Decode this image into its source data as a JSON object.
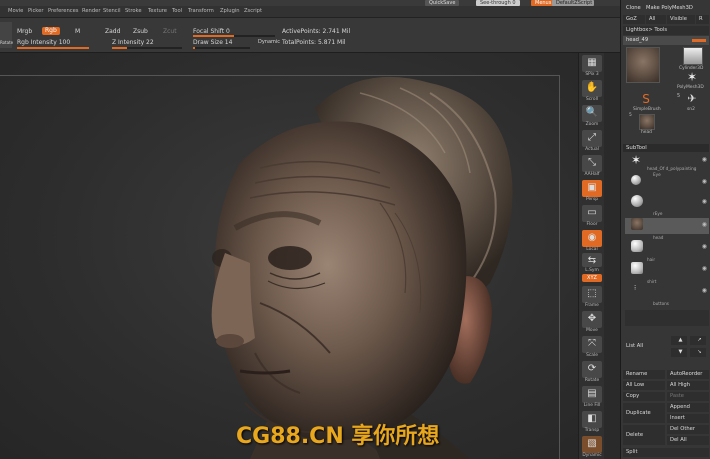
{
  "titlebar": {
    "quicksave": "QuickSave",
    "seethrough": "See-through 0",
    "menus": "Menus",
    "defaultscript": "DefaultZScript"
  },
  "menubar": {
    "items": [
      "Movie",
      "Picker",
      "Preferences",
      "Render",
      "Stencil",
      "Stroke",
      "Texture",
      "Tool",
      "Transform",
      "Zplugin",
      "Zscript"
    ]
  },
  "toolbar": {
    "mrgb": "Mrgb",
    "rgb": "Rgb",
    "m": "M",
    "zadd": "Zadd",
    "zsub": "Zsub",
    "zcut": "Zcut",
    "rgb_intensity": "Rgb Intensity 100",
    "z_intensity": "Z Intensity 22",
    "focal_shift": "Focal Shift 0",
    "draw_size": "Draw Size 14",
    "dynamic": "Dynamic",
    "active_points": "ActivePoints: 2.741 Mil",
    "total_points": "TotalPoints: 5.871 Mil",
    "rgb_intensity_value": 100,
    "z_intensity_value": 22,
    "focal_shift_value": 0,
    "draw_size_value": 14,
    "left_icon_label": "Rotate"
  },
  "shelf": {
    "items": [
      {
        "label": "SPix 3",
        "glyph": "▦"
      },
      {
        "label": "Scroll",
        "glyph": "✋"
      },
      {
        "label": "Zoom",
        "glyph": "🔍"
      },
      {
        "label": "Actual",
        "glyph": "⤢"
      },
      {
        "label": "AAHalf",
        "glyph": "⤡"
      },
      {
        "label": "Persp",
        "glyph": "▣"
      },
      {
        "label": "Floor",
        "glyph": "▭"
      },
      {
        "label": "Local",
        "glyph": "◉"
      },
      {
        "label": "L.Sym",
        "glyph": "⇆"
      },
      {
        "label": "Frame",
        "glyph": "⬚"
      },
      {
        "label": "Move",
        "glyph": "✥"
      },
      {
        "label": "Scale",
        "glyph": "⤧"
      },
      {
        "label": "Rotate",
        "glyph": "⟳"
      },
      {
        "label": "Line Fill",
        "glyph": "▤"
      },
      {
        "label": "Transp",
        "glyph": "◧"
      },
      {
        "label": "Dynamic",
        "glyph": "▧"
      }
    ],
    "xyz": "XYZ"
  },
  "panel": {
    "clone": "Clone",
    "make_polymesh": "Make PolyMesh3D",
    "goz": "GoZ",
    "all": "All",
    "visible": "Visible",
    "r": "R",
    "lightbox_tools": "Lightbox> Tools",
    "head_slider": "head_49",
    "head_value": "49",
    "tools": [
      {
        "name": "Cylinder3D"
      },
      {
        "name": "PolyMesh3D"
      },
      {
        "name": "SimpleBrush"
      },
      {
        "name": "sn2"
      },
      {
        "name": "head"
      },
      {
        "name": "5"
      }
    ],
    "subtool_header": "SubTool",
    "subtools": [
      {
        "name": "head_Of d_polypainting"
      },
      {
        "name": "Eye"
      },
      {
        "name": "rEye"
      },
      {
        "name": "head"
      },
      {
        "name": "hair"
      },
      {
        "name": "shirt"
      },
      {
        "name": "buttons"
      }
    ],
    "list_all": "List All",
    "actions": [
      [
        "Rename",
        "AutoReorder"
      ],
      [
        "All Low",
        "All High"
      ],
      [
        "Copy",
        "Paste"
      ],
      [
        "Duplicate",
        "Append"
      ],
      [
        "",
        "Insert"
      ],
      [
        "Delete",
        "Del Other"
      ],
      [
        "",
        "Del All"
      ],
      [
        "Split",
        ""
      ]
    ]
  },
  "watermark": "CG88.CN 享你所想",
  "colors": {
    "accent": "#e06a24",
    "panel_bg": "#363636",
    "viewport_bg": "#2d2d2d"
  }
}
